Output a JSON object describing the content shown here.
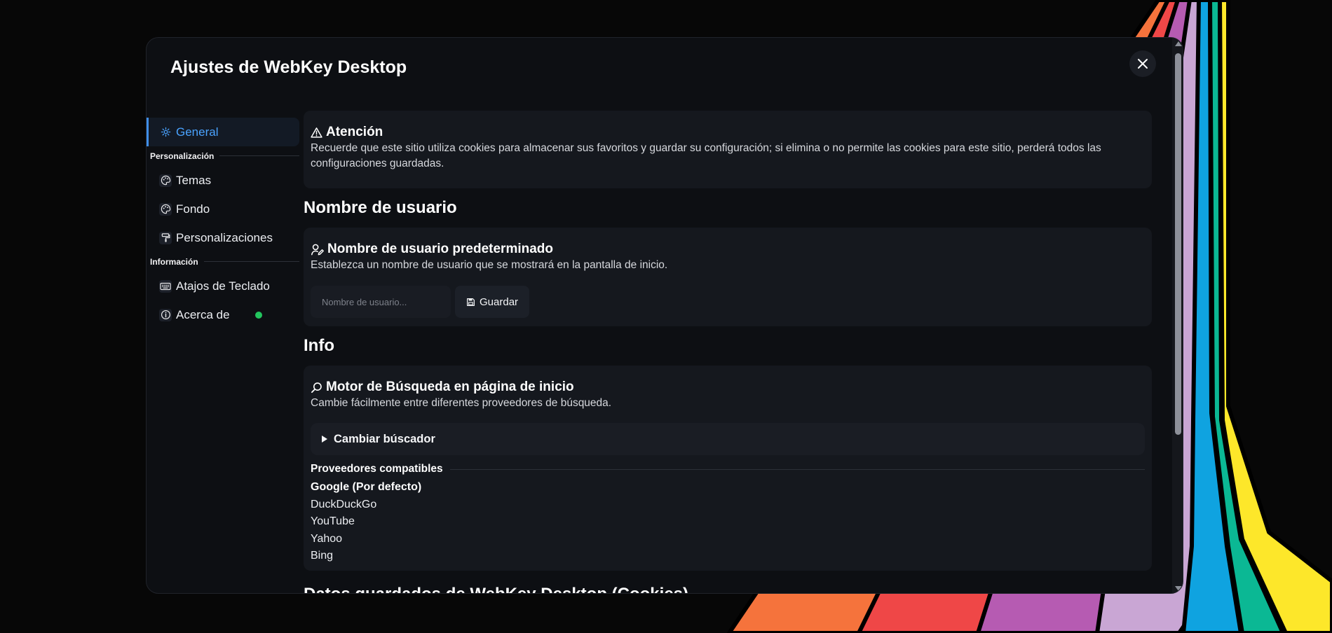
{
  "modal": {
    "title": "Ajustes de WebKey Desktop",
    "close_icon": "x-icon"
  },
  "sidebar": {
    "general": {
      "label": "General",
      "icon": "gear-icon"
    },
    "section_personalization": "Personalización",
    "themes": {
      "label": "Temas",
      "icon": "palette-icon"
    },
    "background": {
      "label": "Fondo",
      "icon": "palette-icon"
    },
    "customizations": {
      "label": "Personalizaciones",
      "icon": "paint-roller-icon"
    },
    "section_info": "Información",
    "shortcuts": {
      "label": "Atajos de Teclado",
      "icon": "keyboard-icon"
    },
    "about": {
      "label": "Acerca de",
      "icon": "info-icon",
      "status_color": "#22c55e"
    }
  },
  "attention": {
    "title": "Atención",
    "icon": "warning-icon",
    "text": "Recuerde que este sitio utiliza cookies para almacenar sus favoritos y guardar su configuración; si elimina o no permite las cookies para este sitio, perderá todos las configuraciones guardadas."
  },
  "username_section": {
    "heading": "Nombre de usuario",
    "card_title": "Nombre de usuario predeterminado",
    "card_icon": "user-pen-icon",
    "card_desc": "Establezca un nombre de usuario que se mostrará en la pantalla de inicio.",
    "input_placeholder": "Nombre de usuario...",
    "input_value": "",
    "save_label": "Guardar",
    "save_icon": "floppy-disk-icon"
  },
  "info_section": {
    "heading": "Info",
    "card_title": "Motor de Búsqueda en página de inicio",
    "card_icon": "search-icon",
    "card_desc": "Cambie fácilmente entre diferentes proveedores de búsqueda.",
    "details_label": "Cambiar búscador",
    "providers_heading": "Proveedores compatibles",
    "providers": [
      {
        "name": "Google (Por defecto)"
      },
      {
        "name": "DuckDuckGo"
      },
      {
        "name": "YouTube"
      },
      {
        "name": "Yahoo"
      },
      {
        "name": "Bing"
      }
    ]
  },
  "next_section": {
    "heading": "Datos guardados de WebKey Desktop (Cookies)"
  },
  "colors": {
    "accent": "#4aa3ff",
    "modal_bg": "#0d0f13",
    "card_bg": "#15181e",
    "stripes": [
      "#f5733c",
      "#ef4747",
      "#b65bb2",
      "#c9a6d4",
      "#0fa3e0",
      "#0bb894",
      "#fde72a"
    ]
  }
}
